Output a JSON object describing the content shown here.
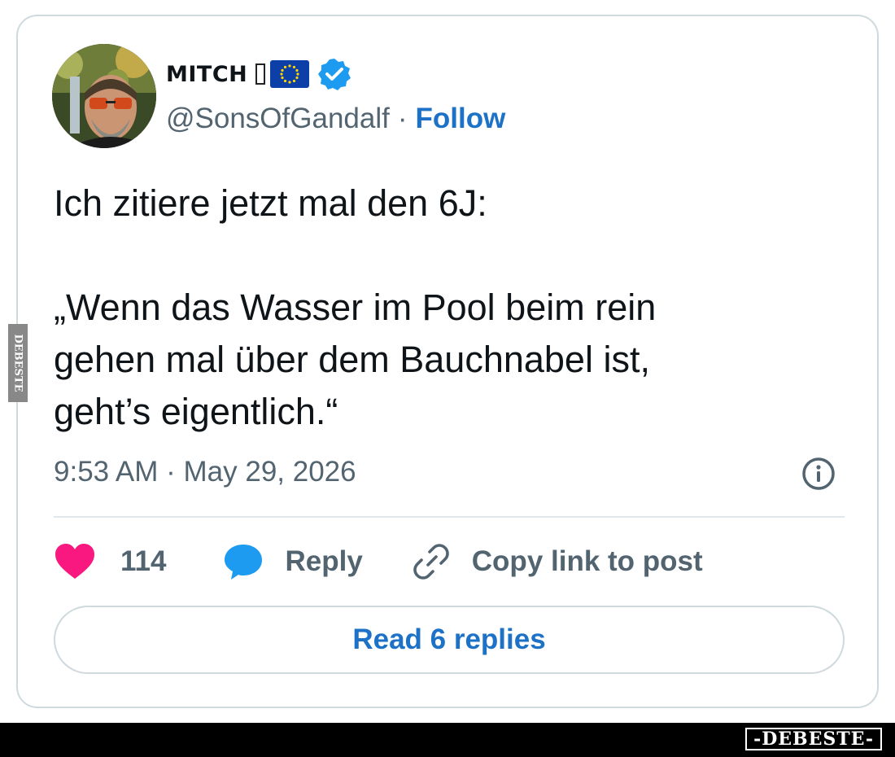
{
  "author": {
    "display_name": "MITCH",
    "handle": "@SonsOfGandalf",
    "separator": "·",
    "follow_label": "Follow",
    "avatar_icon": "profile-photo",
    "verified_icon": "verified-badge-icon",
    "flag_icon": "eu-flag-icon"
  },
  "tweet": {
    "lines_intro": [
      "Ich zitiere jetzt mal den 6J:"
    ],
    "lines_quote": [
      "„Wenn das Wasser im Pool beim rein",
      "gehen mal über dem Bauchnabel ist,",
      "geht’s eigentlich.“"
    ],
    "timestamp": "9:53 AM · May 29, 2026"
  },
  "actions": {
    "like_count": "114",
    "reply_label": "Reply",
    "copy_label": "Copy link to post"
  },
  "read_replies_label": "Read 6 replies",
  "watermark": {
    "logo_text": "-DEBESTE-",
    "side_text": "DEBESTE"
  },
  "colors": {
    "accent": "#1d72c8",
    "like": "#f91880",
    "reply": "#1d9bf0",
    "muted": "#536471",
    "border": "#cfd9de"
  }
}
